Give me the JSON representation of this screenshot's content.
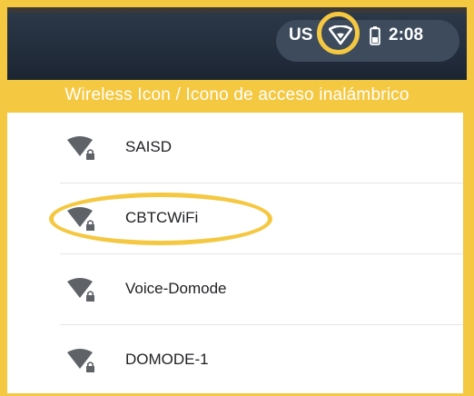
{
  "status_bar": {
    "keyboard_layout": "US",
    "wifi_icon": "wifi-icon",
    "battery_icon": "battery-icon",
    "time": "2:08"
  },
  "caption": "Wireless Icon / Icono de acceso inalámbrico",
  "networks": [
    {
      "ssid": "SAISD",
      "icon": "wifi-locked-icon",
      "highlighted": false
    },
    {
      "ssid": "CBTCWiFi",
      "icon": "wifi-locked-icon",
      "highlighted": true
    },
    {
      "ssid": "Voice-Domode",
      "icon": "wifi-locked-icon",
      "highlighted": false
    },
    {
      "ssid": "DOMODE-1",
      "icon": "wifi-locked-icon",
      "highlighted": false
    }
  ],
  "colors": {
    "highlight": "#f5c842",
    "status_bar": "#1c2532",
    "status_pill": "#3d4b5c",
    "icon": "#5f6368"
  }
}
